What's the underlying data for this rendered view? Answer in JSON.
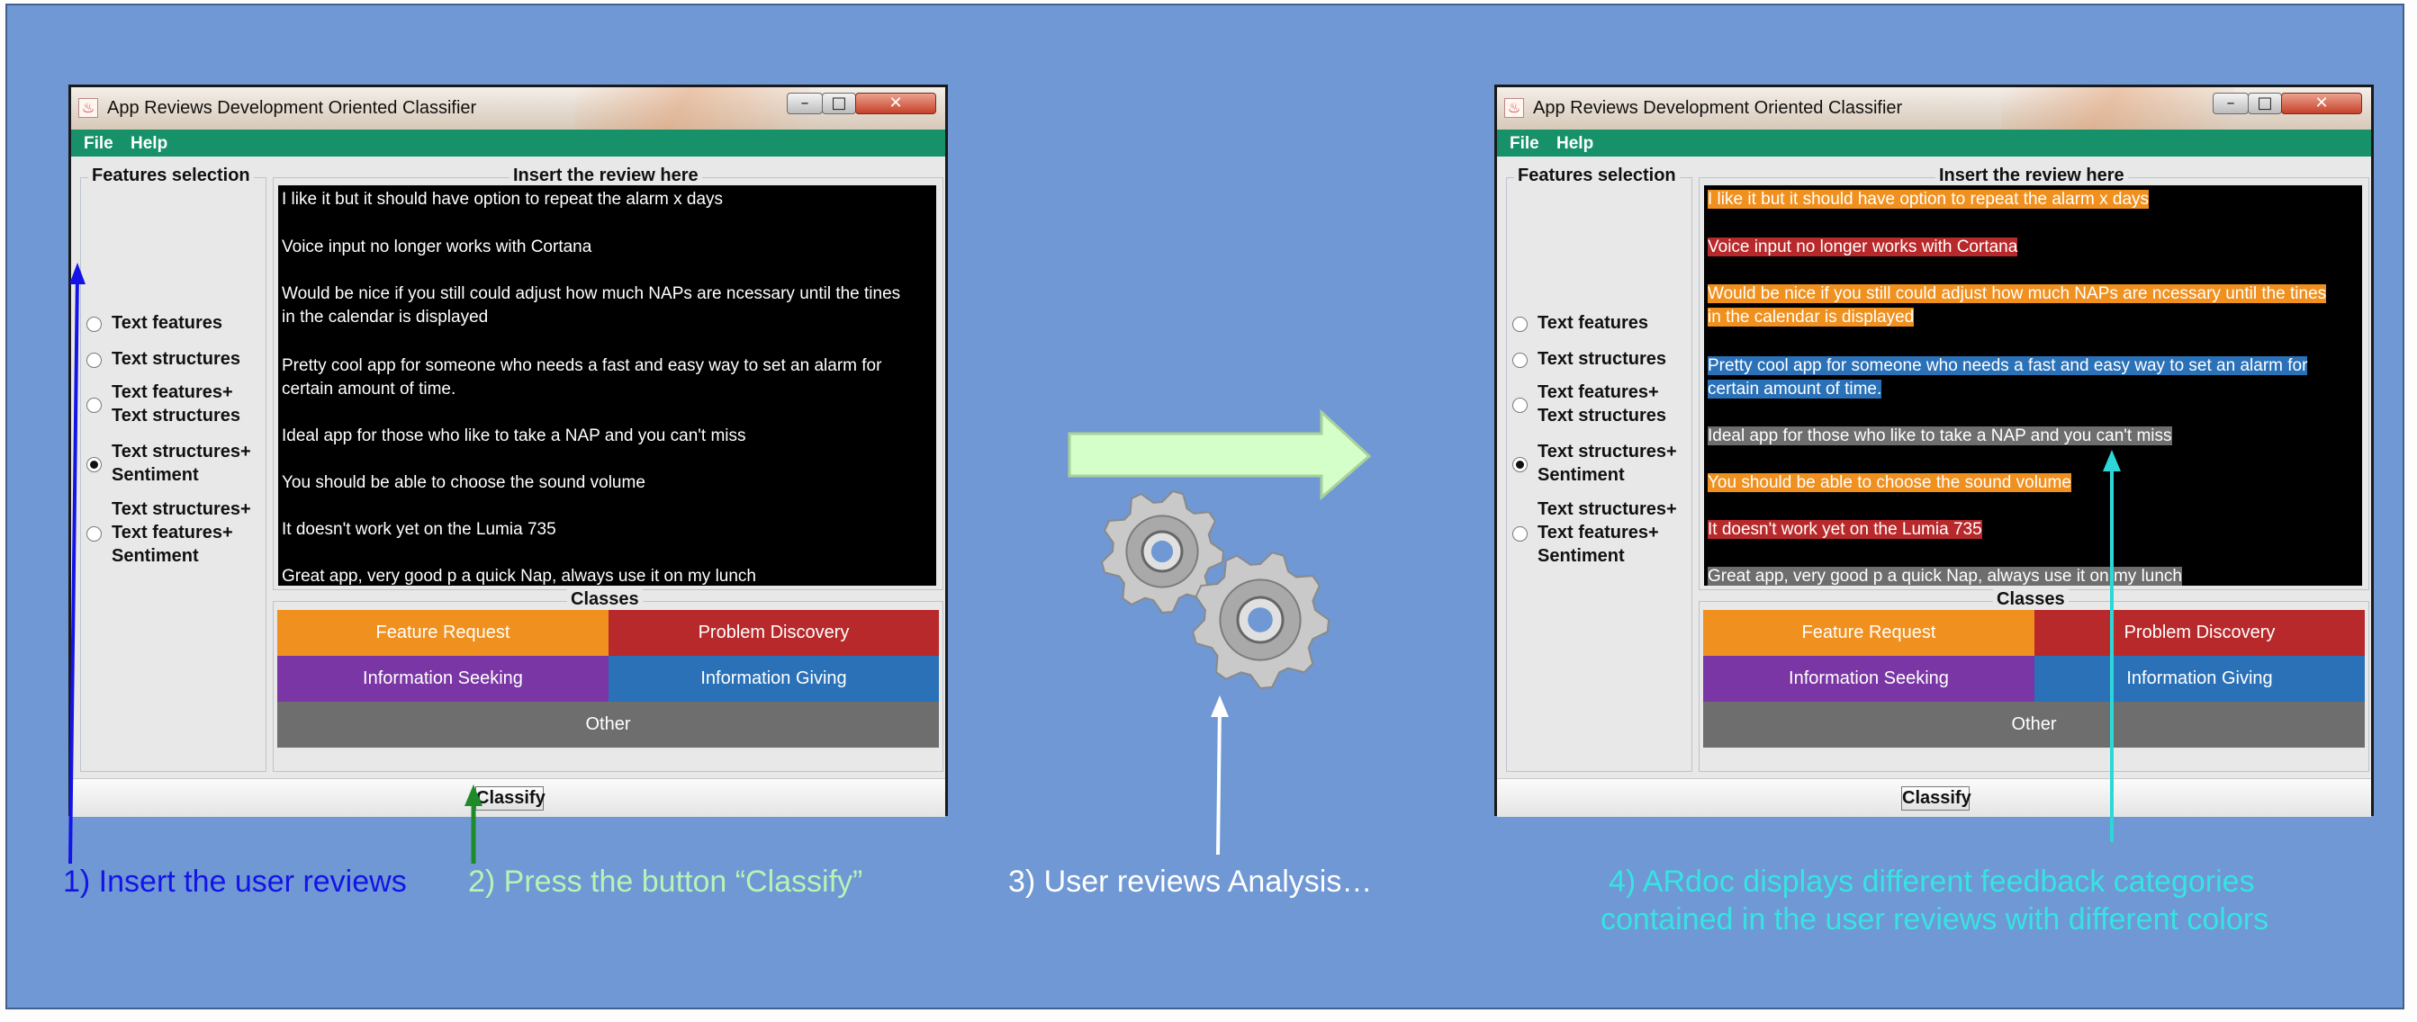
{
  "window": {
    "title": "App Reviews Development Oriented Classifier",
    "menu": [
      "File",
      "Help"
    ],
    "features_legend": "Features selection",
    "options": [
      {
        "lines": [
          "Text features"
        ],
        "selected": false
      },
      {
        "lines": [
          "Text structures"
        ],
        "selected": false
      },
      {
        "lines": [
          "Text features+",
          "Text structures"
        ],
        "selected": false
      },
      {
        "lines": [
          "Text structures+",
          "Sentiment"
        ],
        "selected": true
      },
      {
        "lines": [
          "Text structures+",
          "Text features+",
          "Sentiment"
        ],
        "selected": false
      }
    ],
    "review_legend": "Insert the review here",
    "reviews": [
      {
        "lines": [
          "I like it but it should have option to repeat the alarm x days"
        ],
        "category": "feature_request"
      },
      {
        "lines": [
          "Voice input no longer works with Cortana"
        ],
        "category": "problem_discovery"
      },
      {
        "lines": [
          "Would be nice if you still could adjust how much NAPs are ncessary until the tines",
          "in the calendar is displayed"
        ],
        "category": "feature_request"
      },
      {
        "lines": [
          "Pretty cool app for someone who needs a fast and easy way to set an alarm for",
          "certain amount of time."
        ],
        "category": "information_giving"
      },
      {
        "lines": [
          "Ideal app for those who like to take a NAP and you can't miss"
        ],
        "category": "other"
      },
      {
        "lines": [
          "You should be able to choose the sound volume"
        ],
        "category": "feature_request"
      },
      {
        "lines": [
          "It doesn't work yet on the Lumia 735"
        ],
        "category": "problem_discovery"
      },
      {
        "lines": [
          "Great app, very good p a quick Nap, always use it on my lunch"
        ],
        "category": "other"
      }
    ],
    "classes_legend": "Classes",
    "classes": {
      "feature_request": {
        "label": "Feature Request",
        "color": "#f0901e"
      },
      "problem_discovery": {
        "label": "Problem Discovery",
        "color": "#b8292b"
      },
      "information_seeking": {
        "label": "Information Seeking",
        "color": "#7a36a4"
      },
      "information_giving": {
        "label": "Information Giving",
        "color": "#2a71b8"
      },
      "other": {
        "label": "Other",
        "color": "#6e6e6e"
      }
    },
    "classify_label": "Classify"
  },
  "steps": [
    {
      "text": "1) Insert the user reviews",
      "color": "#1414e6"
    },
    {
      "text": "2) Press the button “Classify”",
      "color": "#b6f3b6"
    },
    {
      "text": "3) User reviews  Analysis…",
      "color": "#ffffff"
    },
    {
      "lines": [
        "4) ARdoc displays different feedback categories",
        "contained in the user reviews with different colors"
      ],
      "color": "#37e3e3"
    }
  ],
  "icons": [
    "flow-arrow-icon",
    "gears-icon"
  ]
}
